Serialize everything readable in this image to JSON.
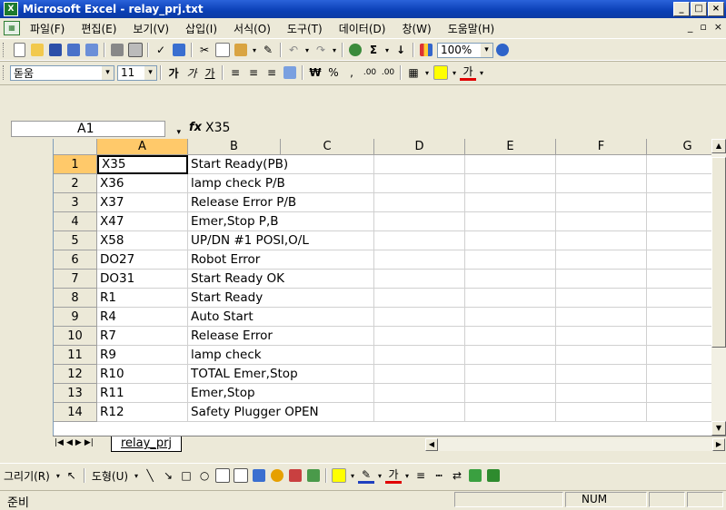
{
  "window": {
    "title": "Microsoft Excel - relay_prj.txt",
    "app_icon_glyph": "X"
  },
  "menu": {
    "items": [
      "파일(F)",
      "편집(E)",
      "보기(V)",
      "삽입(I)",
      "서식(O)",
      "도구(T)",
      "데이터(D)",
      "창(W)",
      "도움말(H)"
    ]
  },
  "toolbar": {
    "zoom": "100%"
  },
  "format_toolbar": {
    "font": "돋움",
    "size": "11",
    "bold": "가",
    "italic": "가",
    "underline": "가",
    "currency": "₩",
    "percent": "%",
    "comma": ",",
    "inc_decimal": ".00",
    "dec_decimal": ".00"
  },
  "formula_bar": {
    "name_box": "A1",
    "fx": "fx",
    "content": "X35"
  },
  "columns": [
    "A",
    "B",
    "C",
    "D",
    "E",
    "F",
    "G"
  ],
  "rows": [
    {
      "n": "1",
      "a": "X35",
      "b": "Start Ready(PB)"
    },
    {
      "n": "2",
      "a": "X36",
      "b": "lamp check P/B"
    },
    {
      "n": "3",
      "a": "X37",
      "b": "Release Error P/B"
    },
    {
      "n": "4",
      "a": "X47",
      "b": "Emer,Stop P,B"
    },
    {
      "n": "5",
      "a": "X58",
      "b": "UP/DN #1 POSI,O/L"
    },
    {
      "n": "6",
      "a": "DO27",
      "b": "Robot Error"
    },
    {
      "n": "7",
      "a": "DO31",
      "b": "Start Ready OK"
    },
    {
      "n": "8",
      "a": "R1",
      "b": "Start Ready"
    },
    {
      "n": "9",
      "a": "R4",
      "b": "Auto Start"
    },
    {
      "n": "10",
      "a": "R7",
      "b": "Release Error"
    },
    {
      "n": "11",
      "a": "R9",
      "b": "lamp check"
    },
    {
      "n": "12",
      "a": "R10",
      "b": "TOTAL  Emer,Stop"
    },
    {
      "n": "13",
      "a": "R11",
      "b": "Emer,Stop"
    },
    {
      "n": "14",
      "a": "R12",
      "b": "Safety Plugger OPEN"
    }
  ],
  "sheet_tab": "relay_prj",
  "drawing_toolbar": {
    "draw": "그리기(R)",
    "autoshapes": "도형(U)",
    "font_color_glyph": "가"
  },
  "status": {
    "text": "준비",
    "num": "NUM"
  },
  "colors": {
    "title_bar": "#0a3fb5",
    "selected_header": "#ffc96a",
    "chrome": "#ece9d8"
  }
}
